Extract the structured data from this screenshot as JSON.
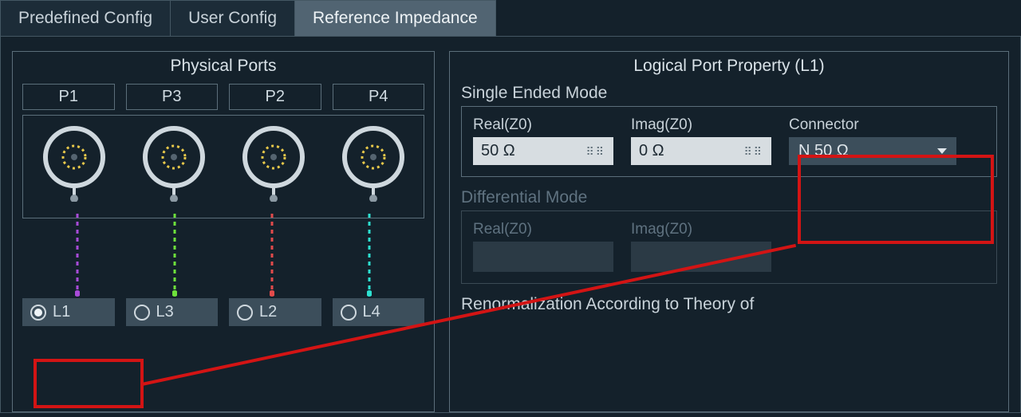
{
  "tabs": {
    "items": [
      {
        "label": "Predefined Config",
        "active": false
      },
      {
        "label": "User Config",
        "active": false
      },
      {
        "label": "Reference Impedance",
        "active": true
      }
    ]
  },
  "physical_ports": {
    "title": "Physical Ports",
    "headers": [
      "P1",
      "P3",
      "P2",
      "P4"
    ],
    "line_colors": [
      "#a84bd8",
      "#6ee23b",
      "#e24b4b",
      "#2de0d0"
    ]
  },
  "logical_ports": {
    "items": [
      {
        "label": "L1",
        "selected": true
      },
      {
        "label": "L3",
        "selected": false
      },
      {
        "label": "L2",
        "selected": false
      },
      {
        "label": "L4",
        "selected": false
      }
    ]
  },
  "property_panel": {
    "title": "Logical Port Property (L1)",
    "single": {
      "label": "Single Ended Mode",
      "real": {
        "label": "Real(Z0)",
        "value": "50 Ω"
      },
      "imag": {
        "label": "Imag(Z0)",
        "value": "0 Ω"
      },
      "connector": {
        "label": "Connector",
        "value": "N 50 Ω"
      }
    },
    "diff": {
      "label": "Differential Mode",
      "real_label": "Real(Z0)",
      "imag_label": "Imag(Z0)"
    },
    "renorm_label": "Renormalization According to Theory of"
  }
}
